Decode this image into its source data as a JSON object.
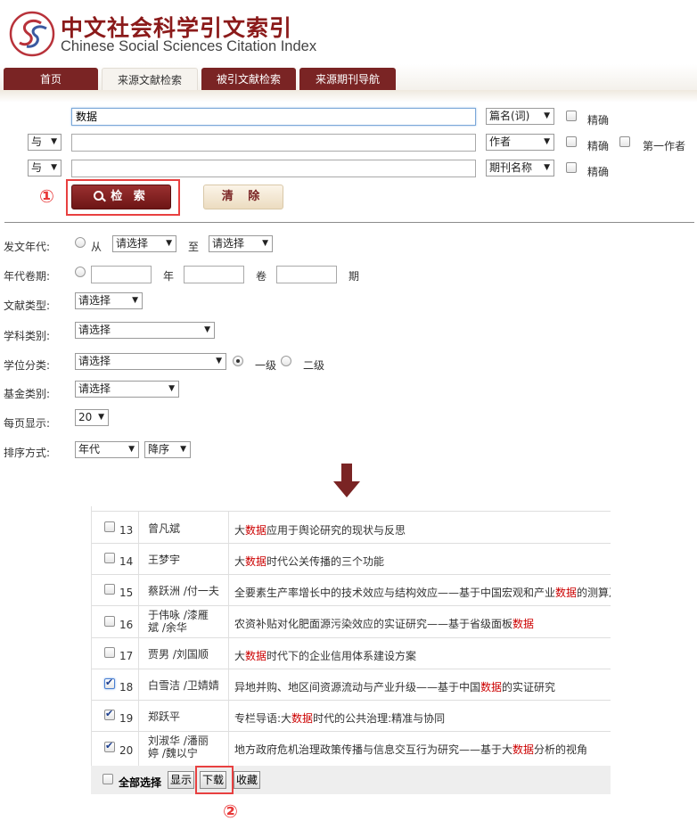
{
  "header": {
    "title_cn": "中文社会科学引文索引",
    "title_en": "Chinese Social Sciences Citation Index"
  },
  "tabs": [
    {
      "label": "首页",
      "active": false
    },
    {
      "label": "来源文献检索",
      "active": true
    },
    {
      "label": "被引文献检索",
      "active": false
    },
    {
      "label": "来源期刊导航",
      "active": false
    }
  ],
  "search": {
    "rows": [
      {
        "logic": "",
        "value": "数据",
        "field": "篇名(词)",
        "exact_label": "精确",
        "exact": false
      },
      {
        "logic": "与",
        "value": "",
        "field": "作者",
        "exact_label": "精确",
        "exact": false,
        "first_author_label": "第一作者",
        "first_author": false
      },
      {
        "logic": "与",
        "value": "",
        "field": "期刊名称",
        "exact_label": "精确",
        "exact": false
      }
    ],
    "search_button": "检 索",
    "clear_button": "清 除",
    "annotation_1": "①",
    "annotation_2": "②"
  },
  "filters": {
    "year_label": "发文年代:",
    "year_from_label": "从",
    "year_from_value": "请选择",
    "year_to_label": "至",
    "year_to_value": "请选择",
    "volume_label": "年代卷期:",
    "volume_year_unit": "年",
    "volume_vol_unit": "卷",
    "volume_issue_unit": "期",
    "doc_type_label": "文献类型:",
    "doc_type_value": "请选择",
    "subject_label": "学科类别:",
    "subject_value": "请选择",
    "degree_label": "学位分类:",
    "degree_value": "请选择",
    "degree_level1": "一级",
    "degree_level2": "二级",
    "fund_label": "基金类别:",
    "fund_value": "请选择",
    "per_page_label": "每页显示:",
    "per_page_value": "20",
    "sort_label": "排序方式:",
    "sort_by_value": "年代",
    "sort_order_value": "降序"
  },
  "results": [
    {
      "num": "13",
      "author": "曾凡斌",
      "title_parts": [
        "大",
        "数据",
        "应用于舆论研究的现状与反思"
      ],
      "checked": false
    },
    {
      "num": "14",
      "author": "王梦宇",
      "title_parts": [
        "大",
        "数据",
        "时代公关传播的三个功能"
      ],
      "checked": false
    },
    {
      "num": "15",
      "author": "蔡跃洲 /付一夫",
      "title_parts": [
        "全要素生产率增长中的技术效应与结构效应——基于中国宏观和产业",
        "数据",
        "的测算及"
      ],
      "checked": false
    },
    {
      "num": "16",
      "author_lines": [
        "于伟咏 /漆雁",
        "斌 /余华"
      ],
      "title_parts": [
        "农资补贴对化肥面源污染效应的实证研究——基于省级面板",
        "数据",
        ""
      ],
      "checked": false
    },
    {
      "num": "17",
      "author": "贾男 /刘国顺",
      "title_parts": [
        "大",
        "数据",
        "时代下的企业信用体系建设方案"
      ],
      "checked": false
    },
    {
      "num": "18",
      "author": "白雪洁 /卫婧婧",
      "title_parts": [
        "异地并购、地区间资源流动与产业升级——基于中国",
        "数据",
        "的实证研究"
      ],
      "checked": true
    },
    {
      "num": "19",
      "author": "郑跃平",
      "title_parts": [
        "专栏导语:大",
        "数据",
        "时代的公共治理:精准与协同"
      ],
      "checked": true
    },
    {
      "num": "20",
      "author_lines": [
        "刘淑华 /潘丽",
        "婷 /魏以宁"
      ],
      "title_parts": [
        "地方政府危机治理政策传播与信息交互行为研究——基于大",
        "数据",
        "分析的视角"
      ],
      "checked": true
    }
  ],
  "bottom": {
    "select_all": "全部选择",
    "show": "显示",
    "download": "下载",
    "favorite": "收藏"
  },
  "colors": {
    "brand": "#7a2424",
    "highlight": "#cc0000",
    "annotation": "#e84040"
  }
}
